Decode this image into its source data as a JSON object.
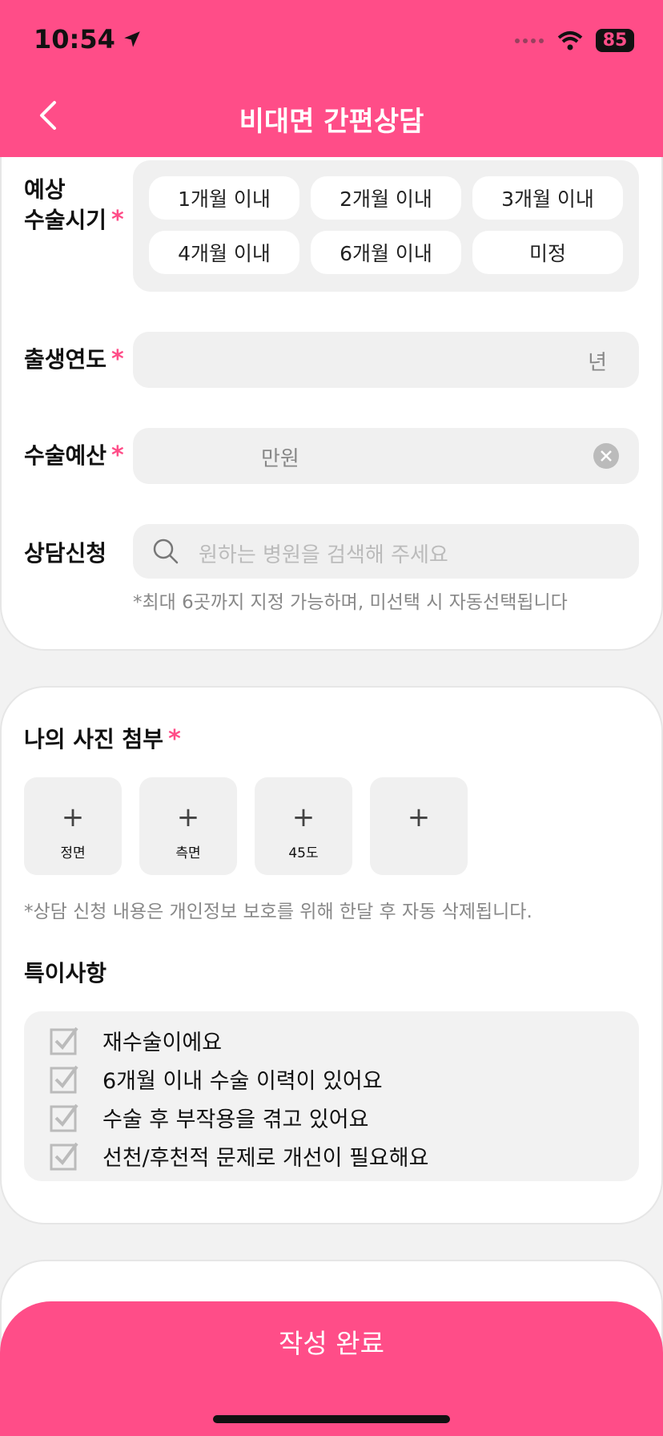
{
  "status": {
    "time": "10:54",
    "battery": "85"
  },
  "header": {
    "title": "비대면 간편상담"
  },
  "surgery_timing": {
    "label_line1": "예상",
    "label_line2": "수술시기",
    "options": [
      "1개월 이내",
      "2개월 이내",
      "3개월 이내",
      "4개월 이내",
      "6개월 이내",
      "미정"
    ]
  },
  "required_mark": "*",
  "birth_year": {
    "label": "출생연도",
    "unit": "년"
  },
  "budget": {
    "label": "수술예산",
    "unit": "만원"
  },
  "consult": {
    "label": "상담신청",
    "placeholder": "원하는 병원을 검색해 주세요",
    "hint": "*최대 6곳까지 지정 가능하며, 미선택 시 자동선택됩니다"
  },
  "photos": {
    "title": "나의 사진 첨부",
    "slots": [
      {
        "caption": "정면"
      },
      {
        "caption": "측면"
      },
      {
        "caption": "45도"
      },
      {
        "caption": ""
      }
    ],
    "plus": "+",
    "notice": "*상담 신청 내용은 개인정보 보호를 위해 한달 후 자동 삭제됩니다."
  },
  "special": {
    "title": "특이사항",
    "items": [
      "재수술이에요",
      "6개월 이내 수술 이력이 있어요",
      "수술 후 부작용을 겪고 있어요",
      "선천/후천적 문제로 개선이 필요해요"
    ]
  },
  "submit": {
    "label": "작성 완료"
  },
  "colors": {
    "accent": "#ff4d88",
    "field_bg": "#f0f0f0"
  }
}
